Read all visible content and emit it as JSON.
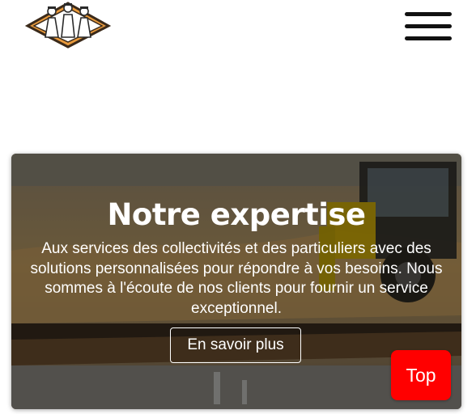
{
  "header": {
    "logo_icon": "team-workers-logo",
    "menu_icon": "hamburger-icon"
  },
  "hero": {
    "title": "Notre expertise",
    "description": "Aux services des collectivités et des particuliers avec des solutions personnalisées pour répondre à vos besoins. Nous sommes à l'écoute de nos clients pour fournir un service exceptionnel.",
    "cta_label": "En savoir plus",
    "background_image": "construction-excavator-photo"
  },
  "top_button": {
    "label": "Top",
    "color": "#ff0000"
  }
}
